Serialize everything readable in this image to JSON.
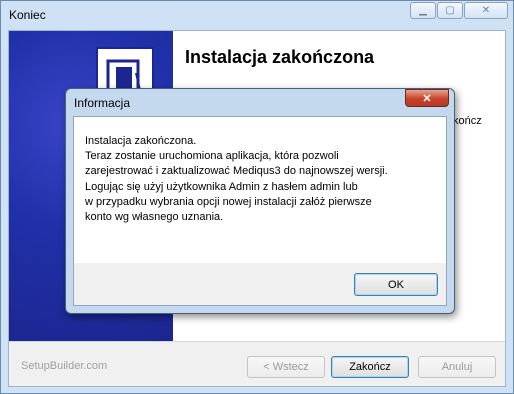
{
  "window": {
    "title": "Koniec",
    "controls": {
      "minimize": "minimize-icon",
      "maximize": "maximize-icon",
      "close": "close-icon"
    }
  },
  "main": {
    "heading": "Instalacja zakończona",
    "partial_text": "kończ"
  },
  "footer": {
    "brand": "SetupBuilder.com",
    "back_label": "< Wstecz",
    "finish_label": "Zakończ",
    "cancel_label": "Anuluj"
  },
  "dialog": {
    "title": "Informacja",
    "message_lines": [
      "Instalacja zakończona.",
      "Teraz zostanie uruchomiona aplikacja, która pozwoli",
      "zarejestrować i zaktualizować Mediqus3 do najnowszej wersji.",
      "Logując się użyj użytkownika Admin z hasłem admin lub",
      "w przypadku wybrania opcji nowej instalacji załóż pierwsze",
      "konto wg własnego uznania."
    ],
    "ok_label": "OK"
  },
  "colors": {
    "side_panel": "#2030a8",
    "dialog_close": "#c7432a",
    "frame": "#cfe2f5"
  }
}
